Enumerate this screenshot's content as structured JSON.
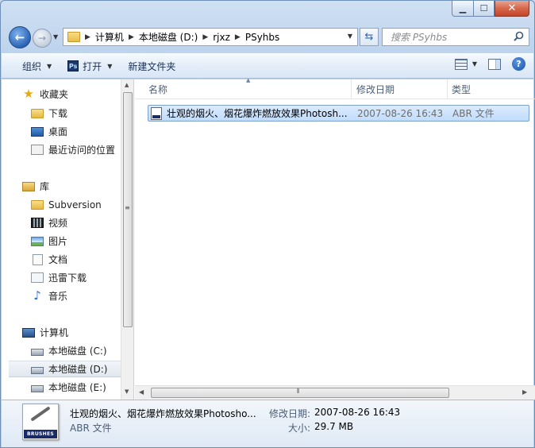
{
  "window": {
    "minimize_label": "▁",
    "maximize_label": "☐",
    "close_label": "✕"
  },
  "address_bar": {
    "crumbs": [
      "计算机",
      "本地磁盘 (D:)",
      "rjxz",
      "PSyhbs"
    ],
    "search_placeholder": "搜索 PSyhbs"
  },
  "toolbar": {
    "organize": "组织",
    "open": "打开",
    "new_folder": "新建文件夹"
  },
  "nav": {
    "favorites_header": "收藏夹",
    "favorites": [
      "下载",
      "桌面",
      "最近访问的位置"
    ],
    "libraries_header": "库",
    "libraries": [
      "Subversion",
      "视频",
      "图片",
      "文档",
      "迅雷下载",
      "音乐"
    ],
    "computer_header": "计算机",
    "drives": [
      "本地磁盘 (C:)",
      "本地磁盘 (D:)",
      "本地磁盘 (E:)"
    ],
    "selected_drive": "本地磁盘 (D:)"
  },
  "columns": [
    "名称",
    "修改日期",
    "类型"
  ],
  "files": [
    {
      "name": "壮观的烟火、烟花爆炸燃放效果Photosh...",
      "modified": "2007-08-26 16:43",
      "type": "ABR 文件"
    }
  ],
  "details": {
    "name": "壮观的烟火、烟花爆炸燃放效果Photosho...",
    "type": "ABR 文件",
    "modified_label": "修改日期:",
    "modified_value": "2007-08-26 16:43",
    "size_label": "大小:",
    "size_value": "29.7 MB",
    "thumb_text": "BRUSHES"
  }
}
